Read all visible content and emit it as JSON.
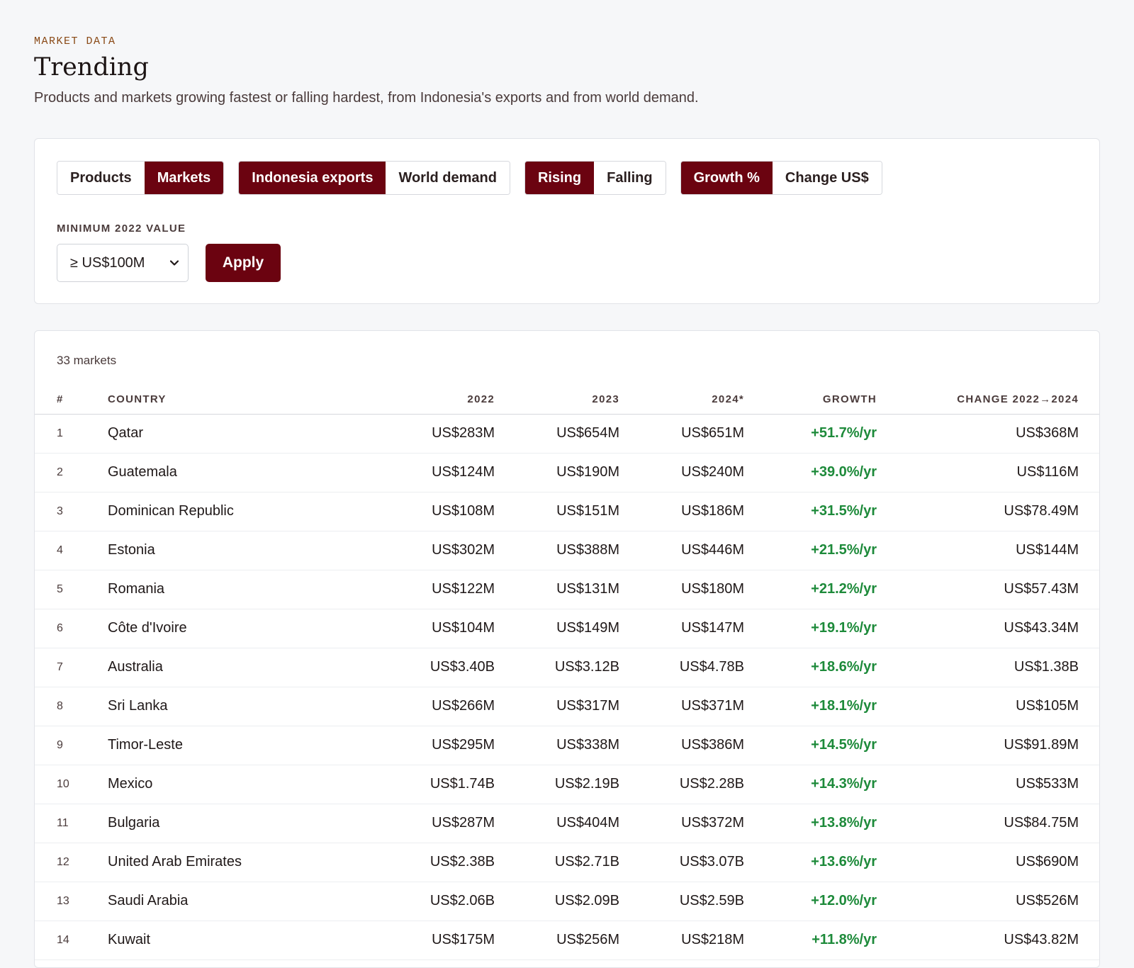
{
  "header": {
    "eyebrow": "MARKET DATA",
    "title": "Trending",
    "subtitle": "Products and markets growing fastest or falling hardest, from Indonesia's exports and from world demand."
  },
  "filters": {
    "type": {
      "options": [
        "Products",
        "Markets"
      ],
      "selected": "Markets"
    },
    "source": {
      "options": [
        "Indonesia exports",
        "World demand"
      ],
      "selected": "Indonesia exports"
    },
    "direction": {
      "options": [
        "Rising",
        "Falling"
      ],
      "selected": "Rising"
    },
    "metric": {
      "options": [
        "Growth %",
        "Change US$"
      ],
      "selected": "Growth %"
    },
    "min_label": "MINIMUM 2022 VALUE",
    "min_value": "≥ US$100M",
    "apply_label": "Apply"
  },
  "results": {
    "count_text": "33 markets",
    "columns": {
      "num": "#",
      "country": "COUNTRY",
      "y2022": "2022",
      "y2023": "2023",
      "y2024": "2024*",
      "growth": "GROWTH",
      "change": "CHANGE 2022→2024"
    },
    "rows": [
      {
        "num": "1",
        "country": "Qatar",
        "y2022": "US$283M",
        "y2023": "US$654M",
        "y2024": "US$651M",
        "growth": "+51.7%/yr",
        "change": "US$368M"
      },
      {
        "num": "2",
        "country": "Guatemala",
        "y2022": "US$124M",
        "y2023": "US$190M",
        "y2024": "US$240M",
        "growth": "+39.0%/yr",
        "change": "US$116M"
      },
      {
        "num": "3",
        "country": "Dominican Republic",
        "y2022": "US$108M",
        "y2023": "US$151M",
        "y2024": "US$186M",
        "growth": "+31.5%/yr",
        "change": "US$78.49M"
      },
      {
        "num": "4",
        "country": "Estonia",
        "y2022": "US$302M",
        "y2023": "US$388M",
        "y2024": "US$446M",
        "growth": "+21.5%/yr",
        "change": "US$144M"
      },
      {
        "num": "5",
        "country": "Romania",
        "y2022": "US$122M",
        "y2023": "US$131M",
        "y2024": "US$180M",
        "growth": "+21.2%/yr",
        "change": "US$57.43M"
      },
      {
        "num": "6",
        "country": "Côte d'Ivoire",
        "y2022": "US$104M",
        "y2023": "US$149M",
        "y2024": "US$147M",
        "growth": "+19.1%/yr",
        "change": "US$43.34M"
      },
      {
        "num": "7",
        "country": "Australia",
        "y2022": "US$3.40B",
        "y2023": "US$3.12B",
        "y2024": "US$4.78B",
        "growth": "+18.6%/yr",
        "change": "US$1.38B"
      },
      {
        "num": "8",
        "country": "Sri Lanka",
        "y2022": "US$266M",
        "y2023": "US$317M",
        "y2024": "US$371M",
        "growth": "+18.1%/yr",
        "change": "US$105M"
      },
      {
        "num": "9",
        "country": "Timor-Leste",
        "y2022": "US$295M",
        "y2023": "US$338M",
        "y2024": "US$386M",
        "growth": "+14.5%/yr",
        "change": "US$91.89M"
      },
      {
        "num": "10",
        "country": "Mexico",
        "y2022": "US$1.74B",
        "y2023": "US$2.19B",
        "y2024": "US$2.28B",
        "growth": "+14.3%/yr",
        "change": "US$533M"
      },
      {
        "num": "11",
        "country": "Bulgaria",
        "y2022": "US$287M",
        "y2023": "US$404M",
        "y2024": "US$372M",
        "growth": "+13.8%/yr",
        "change": "US$84.75M"
      },
      {
        "num": "12",
        "country": "United Arab Emirates",
        "y2022": "US$2.38B",
        "y2023": "US$2.71B",
        "y2024": "US$3.07B",
        "growth": "+13.6%/yr",
        "change": "US$690M"
      },
      {
        "num": "13",
        "country": "Saudi Arabia",
        "y2022": "US$2.06B",
        "y2023": "US$2.09B",
        "y2024": "US$2.59B",
        "growth": "+12.0%/yr",
        "change": "US$526M"
      },
      {
        "num": "14",
        "country": "Kuwait",
        "y2022": "US$175M",
        "y2023": "US$256M",
        "y2024": "US$218M",
        "growth": "+11.8%/yr",
        "change": "US$43.82M"
      }
    ]
  }
}
